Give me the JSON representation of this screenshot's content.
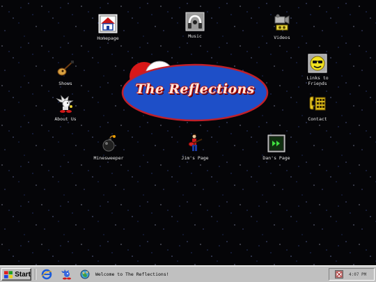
{
  "desktop": {
    "logo_text": "The Reflections",
    "icons": [
      {
        "label": "Homepage",
        "icon": "house-icon"
      },
      {
        "label": "Music",
        "icon": "headphones-icon"
      },
      {
        "label": "Videos",
        "icon": "video-camera-icon"
      },
      {
        "label": "Shows",
        "icon": "guitar-icon"
      },
      {
        "label": "Links to\nFriends",
        "icon": "smiley-sunglasses-icon"
      },
      {
        "label": "About Us",
        "icon": "sonic-character-icon"
      },
      {
        "label": "Contact",
        "icon": "phone-icon"
      },
      {
        "label": "Minesweeper",
        "icon": "bomb-icon"
      },
      {
        "label": "Jim's Page",
        "icon": "guitarist-icon"
      },
      {
        "label": "Dan's Page",
        "icon": "media-player-icon"
      }
    ]
  },
  "taskbar": {
    "start_label": "Start",
    "welcome": "Welcome to The Reflections!",
    "clock": "4:07 PM",
    "quick_launch": [
      "internet-explorer-icon",
      "sonic-icon",
      "earth-dog-icon"
    ],
    "tray_icon": "tray-app-icon"
  },
  "colors": {
    "background": "#050508",
    "logo_ellipse": "#1e4fc8",
    "logo_border": "#c0202a",
    "taskbar": "#c0c0c0"
  }
}
